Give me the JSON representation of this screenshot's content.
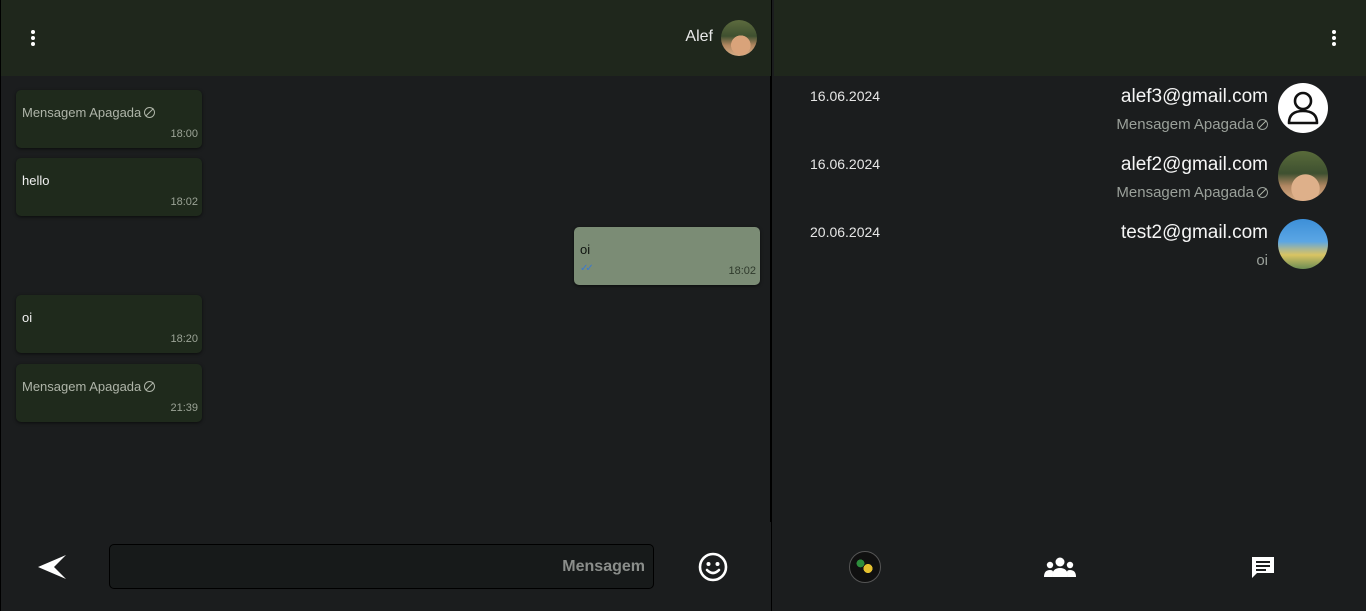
{
  "chat": {
    "contact_name": "Alef",
    "messages": [
      {
        "text": "Mensagem Apagada",
        "time": "18:00",
        "deleted": true,
        "outgoing": false
      },
      {
        "text": "hello",
        "time": "18:02",
        "deleted": false,
        "outgoing": false
      },
      {
        "text": "oi",
        "time": "18:02",
        "deleted": false,
        "outgoing": true,
        "ticks": "✓✓"
      },
      {
        "text": "oi",
        "time": "18:20",
        "deleted": false,
        "outgoing": false
      },
      {
        "text": "Mensagem Apagada",
        "time": "21:39",
        "deleted": true,
        "outgoing": false
      }
    ],
    "composer": {
      "placeholder": "Mensagem"
    }
  },
  "conversations": [
    {
      "date": "16.06.2024",
      "email": "alef3@gmail.com",
      "preview": "Mensagem Apagada",
      "deleted": true,
      "avatar": "default-user-icon"
    },
    {
      "date": "16.06.2024",
      "email": "alef2@gmail.com",
      "preview": "Mensagem Apagada",
      "deleted": true,
      "avatar": "photo"
    },
    {
      "date": "20.06.2024",
      "email": "test2@gmail.com",
      "preview": "oi",
      "deleted": false,
      "avatar": "city-photo"
    }
  ],
  "colors": {
    "header_bg": "#1f271c",
    "panel_bg": "#1b1d1e",
    "incoming_bubble": "#1f2a1c",
    "outgoing_bubble": "#7b8c75",
    "read_ticks": "#3a78d0"
  },
  "icons": {
    "menu": "kebab-menu-icon",
    "send": "send-icon",
    "emoji": "emoji-icon",
    "deleted": "ban-icon",
    "nav_status": "globe-icon",
    "nav_groups": "group-icon",
    "nav_chats": "chat-icon"
  }
}
